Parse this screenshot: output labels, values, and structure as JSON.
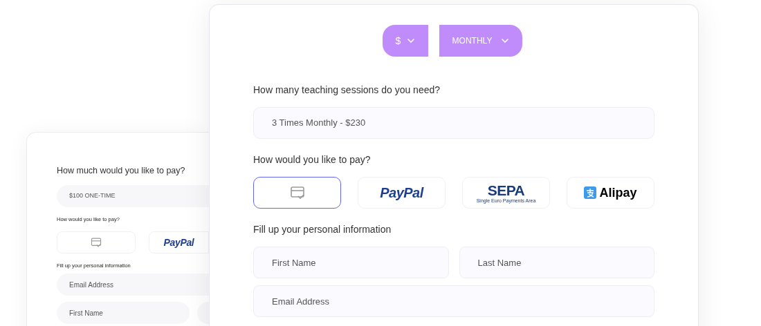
{
  "back_form": {
    "amount_question": "How much would you like to pay?",
    "amount_value": "$100 ONE-TIME",
    "pay_question": "How would you like to pay?",
    "payment_methods": [
      {
        "kind": "card",
        "selected": false
      },
      {
        "kind": "paypal",
        "label": "PayPal",
        "selected": false
      }
    ],
    "personal_heading": "Fill up your personal information",
    "fields": [
      {
        "placeholder": "Email Address"
      },
      {
        "placeholder": "First Name"
      }
    ]
  },
  "front_form": {
    "currency": "$",
    "period": "MONTHLY",
    "sessions_question": "How many teaching sessions do you need?",
    "sessions_value": "3 Times Monthly - $230",
    "pay_question": "How would you like to pay?",
    "payment_methods": [
      {
        "kind": "card",
        "selected": true
      },
      {
        "kind": "paypal",
        "label": "PayPal",
        "selected": false
      },
      {
        "kind": "sepa",
        "label": "SEPA",
        "sublabel": "Single Euro Payments Area",
        "selected": false
      },
      {
        "kind": "alipay",
        "label": "Alipay",
        "selected": false
      }
    ],
    "personal_heading": "Fill up your personal information",
    "name_fields": [
      {
        "placeholder": "First Name"
      },
      {
        "placeholder": "Last Name"
      }
    ],
    "email_field": {
      "placeholder": "Email Address"
    }
  }
}
